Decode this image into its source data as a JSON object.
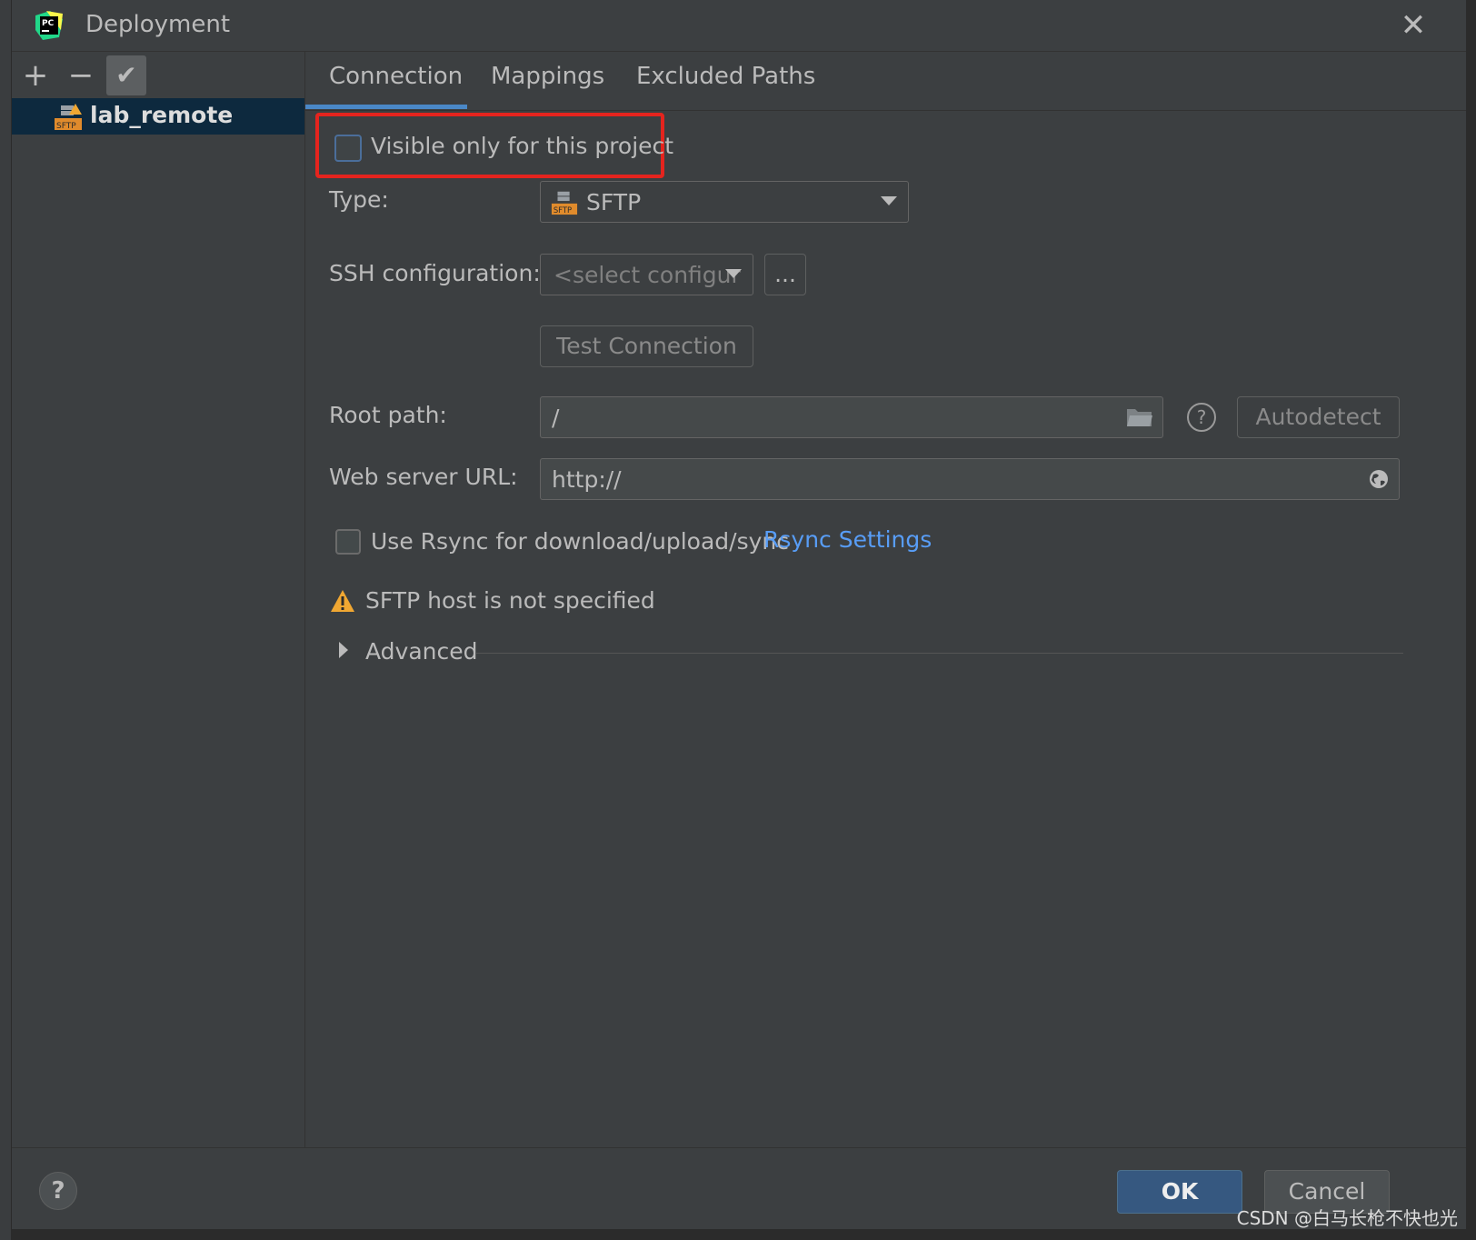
{
  "dialog": {
    "title": "Deployment",
    "close_symbol": "✕"
  },
  "toolbar": {
    "add": "+",
    "remove": "−",
    "apply": "✔"
  },
  "servers": [
    {
      "name": "lab_remote"
    }
  ],
  "tabs": [
    {
      "label": "Connection",
      "active": true
    },
    {
      "label": "Mappings"
    },
    {
      "label": "Excluded Paths"
    }
  ],
  "connection": {
    "visible_only_label": "Visible only for this project",
    "type_label": "Type:",
    "type_value": "SFTP",
    "ssh_label": "SSH configuration:",
    "ssh_placeholder": "<select configur",
    "ssh_more": "...",
    "test_connection": "Test Connection",
    "root_path_label": "Root path:",
    "root_path_value": "/",
    "autodetect": "Autodetect",
    "help": "?",
    "web_url_label": "Web server URL:",
    "web_url_value": "http://",
    "rsync_label": "Use Rsync for download/upload/sync",
    "rsync_settings": "Rsync Settings",
    "warning": "SFTP host is not specified",
    "advanced": "Advanced"
  },
  "footer": {
    "help": "?",
    "ok": "OK",
    "cancel": "Cancel"
  },
  "watermark": "CSDN @白马长枪不快也光",
  "icons": [
    "pycharm-logo-icon",
    "close-icon",
    "plus-icon",
    "minus-icon",
    "check-icon",
    "sftp-server-icon",
    "chevron-down-icon",
    "folder-icon",
    "help-icon",
    "globe-icon",
    "warning-icon",
    "triangle-right-icon"
  ],
  "colors": {
    "accent": "#4a88c7",
    "highlight_box": "#e5241e",
    "link": "#589df6",
    "warning": "#f0a732",
    "ok_button": "#365880"
  }
}
